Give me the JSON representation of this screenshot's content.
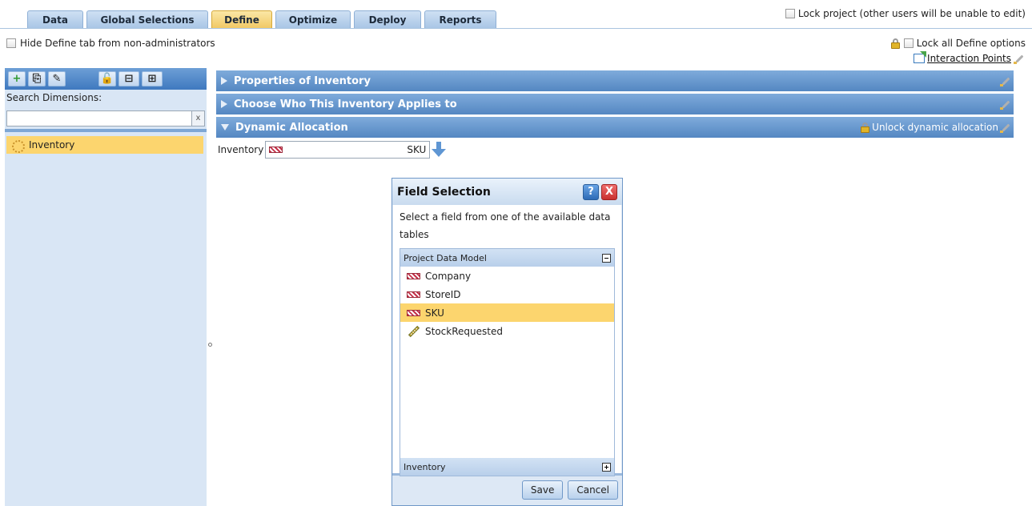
{
  "tabs": [
    "Data",
    "Global Selections",
    "Define",
    "Optimize",
    "Deploy",
    "Reports"
  ],
  "active_tab": "Define",
  "lock_project_label": "Lock project (other users will be unable to edit)",
  "hide_define_label": "Hide Define tab from non-administrators",
  "lock_all_label": "Lock all Define options",
  "interaction_points_label": "Interaction Points",
  "left_panel": {
    "search_label": "Search Dimensions:",
    "search_value": "",
    "clear_label": "x",
    "dimensions": [
      {
        "label": "Inventory"
      }
    ]
  },
  "sections": {
    "properties": "Properties of Inventory",
    "applies": "Choose Who This Inventory Applies to",
    "dynamic": "Dynamic Allocation",
    "unlock_label": "Unlock dynamic allocation"
  },
  "inventory_row": {
    "label": "Inventory",
    "value": "SKU"
  },
  "dialog": {
    "title": "Field Selection",
    "help": "?",
    "close": "X",
    "description": "Select a field from one of the available data tables",
    "tree_header": "Project Data Model",
    "fields": [
      "Company",
      "StoreID",
      "SKU",
      "StockRequested"
    ],
    "selected_field": "SKU",
    "tree_footer": "Inventory",
    "save_label": "Save",
    "cancel_label": "Cancel"
  },
  "colors": {
    "accent": "#5487c2",
    "selected": "#fcd56e",
    "active_tab": "#f1c965"
  }
}
